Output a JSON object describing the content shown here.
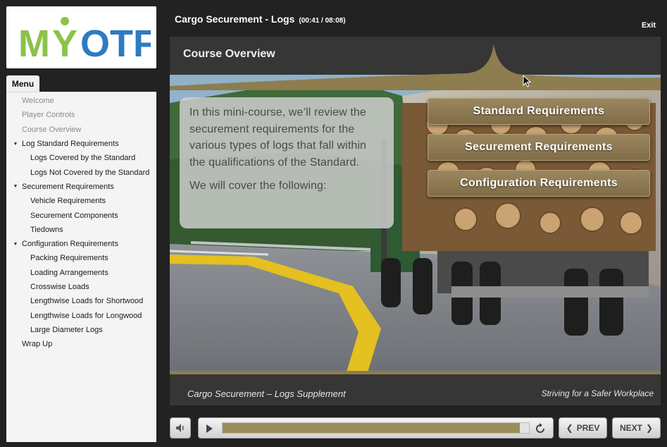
{
  "logo": {
    "text": "MYOTF",
    "colors": {
      "green": "#8bc34a",
      "blue": "#2e7bbf"
    }
  },
  "header": {
    "title": "Cargo Securement - Logs",
    "time": "(00:41 / 08:08)",
    "exit_label": "Exit"
  },
  "menu": {
    "tab_label": "Menu",
    "items": [
      {
        "label": "Welcome",
        "level": 0,
        "dim": true,
        "arrow": false
      },
      {
        "label": "Player Controls",
        "level": 0,
        "dim": true,
        "arrow": false
      },
      {
        "label": "Course Overview",
        "level": 0,
        "dim": true,
        "arrow": false
      },
      {
        "label": "Log Standard Requirements",
        "level": 0,
        "dim": false,
        "arrow": true
      },
      {
        "label": "Logs Covered by the Standard",
        "level": 1,
        "dim": false,
        "arrow": false
      },
      {
        "label": "Logs Not Covered by the Standard",
        "level": 1,
        "dim": false,
        "arrow": false
      },
      {
        "label": "Securement Requirements",
        "level": 0,
        "dim": false,
        "arrow": true
      },
      {
        "label": "Vehicle Requirements",
        "level": 1,
        "dim": false,
        "arrow": false
      },
      {
        "label": "Securement Components",
        "level": 1,
        "dim": false,
        "arrow": false
      },
      {
        "label": "Tiedowns",
        "level": 1,
        "dim": false,
        "arrow": false
      },
      {
        "label": "Configuration Requirements",
        "level": 0,
        "dim": false,
        "arrow": true
      },
      {
        "label": "Packing Requirements",
        "level": 1,
        "dim": false,
        "arrow": false
      },
      {
        "label": "Loading Arrangements",
        "level": 1,
        "dim": false,
        "arrow": false
      },
      {
        "label": "Crosswise Loads",
        "level": 1,
        "dim": false,
        "arrow": false
      },
      {
        "label": "Lengthwise Loads for Shortwood",
        "level": 1,
        "dim": false,
        "arrow": false
      },
      {
        "label": "Lengthwise Loads for Longwood",
        "level": 1,
        "dim": false,
        "arrow": false
      },
      {
        "label": "Large Diameter Logs",
        "level": 1,
        "dim": false,
        "arrow": false
      },
      {
        "label": "Wrap Up",
        "level": 0,
        "dim": false,
        "arrow": false
      }
    ]
  },
  "slide": {
    "title": "Course Overview",
    "intro_text": "In this mini-course, we’ll review the securement requirements for the various types of logs that fall within the qualifications of the Standard.",
    "intro_followup": "We will cover the following:",
    "buttons": {
      "standard": "Standard Requirements",
      "securement": "Securement Requirements",
      "configuration": "Configuration Requirements"
    },
    "footer_left": "Cargo Securement – Logs Supplement",
    "footer_right": "Striving for a Safer Workplace"
  },
  "player": {
    "progress": 0.97,
    "prev_label": "PREV",
    "next_label": "NEXT",
    "accent": "#9a8f58"
  }
}
